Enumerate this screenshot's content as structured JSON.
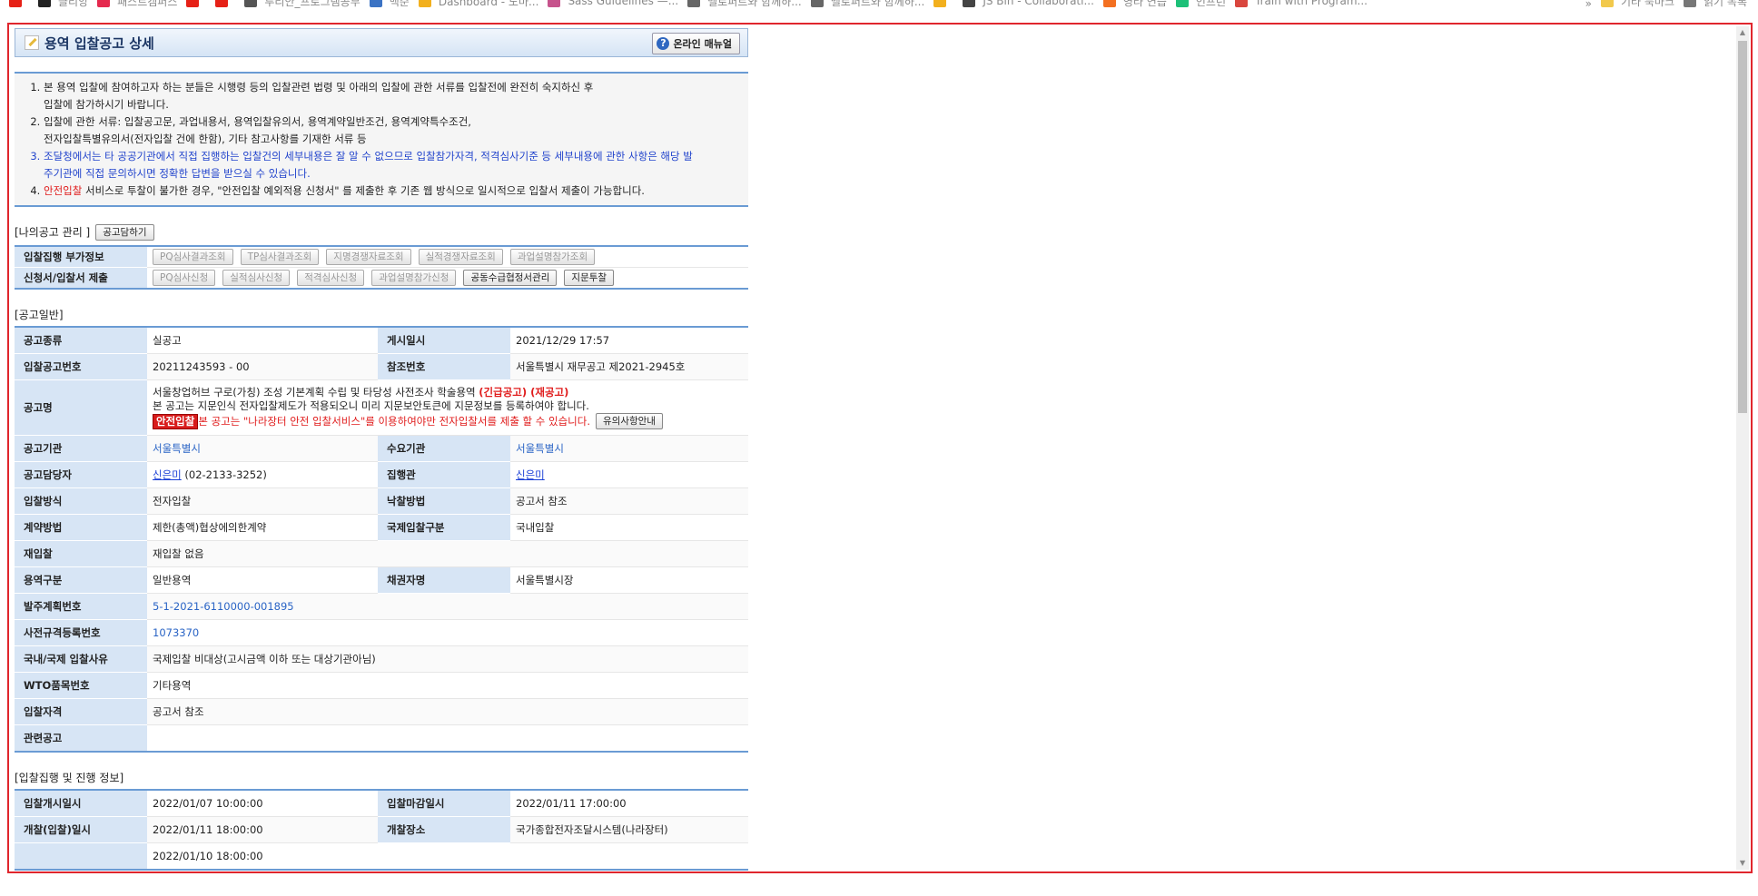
{
  "bookmarks": [
    {
      "icon": "youtube-icon",
      "label": ""
    },
    {
      "icon": "c-icon",
      "label": "클리앙"
    },
    {
      "icon": "fastcampus-icon",
      "label": "패스트캠퍼스"
    },
    {
      "icon": "youtube-icon",
      "label": ""
    },
    {
      "icon": "youtube-icon",
      "label": ""
    },
    {
      "icon": "branch-icon",
      "label": "투리안_프로그램공부"
    },
    {
      "icon": "code-icon",
      "label": "백준"
    },
    {
      "icon": "triangle-icon",
      "label": "Dashboard - 노마..."
    },
    {
      "icon": "sass-icon",
      "label": "Sass Guidelines —..."
    },
    {
      "icon": "book-icon",
      "label": "벨로퍼트와 함께하..."
    },
    {
      "icon": "book-icon",
      "label": "벨로퍼트와 함께하..."
    },
    {
      "icon": "triangle-icon",
      "label": ""
    },
    {
      "icon": "jsbin-icon",
      "label": "JS Bin - Collaborati..."
    },
    {
      "icon": "fire-icon",
      "label": "영타 연습"
    },
    {
      "icon": "inflearn-icon",
      "label": "인프런"
    },
    {
      "icon": "train-icon",
      "label": "Train with Program..."
    }
  ],
  "bookmarks_right": {
    "more": "»",
    "folder": "기타 북마크",
    "reading": "읽기 목록"
  },
  "title": "용역 입찰공고 상세",
  "manual_button": "온라인 매뉴얼",
  "notice": {
    "item1": "본 용역 입찰에 참여하고자 하는 분들은 시행령 등의 입찰관련 법령 및 아래의 입찰에 관한 서류를 입찰전에 완전히 숙지하신 후",
    "item1b": "입찰에 참가하시기 바랍니다.",
    "item2": "입찰에 관한 서류: 입찰공고문, 과업내용서, 용역입찰유의서, 용역계약일반조건, 용역계약특수조건,",
    "item2b": "전자입찰특별유의서(전자입찰 건에 한함), 기타 참고사항를 기재한 서류 등",
    "item3": "조달청에서는 타 공공기관에서 직접 집행하는 입찰건의 세부내용은 잘 알 수 없으므로 입찰참가자격, 적격심사기준 등 세부내용에 관한 사항은 해당 발",
    "item3b": "주기관에 직접 문의하시면 정확한 답변을 받으실 수 있습니다.",
    "item4_red": "안전입찰",
    "item4": " 서비스로 투찰이 불가한 경우, \"안전입찰 예외적용 신청서\" 를 제출한 후 기존 웹 방식으로 일시적으로 입찰서 제출이 가능합니다."
  },
  "my_notice": {
    "label": "[나의공고 관리 ]",
    "button": "공고담하기"
  },
  "extra": {
    "row1_label": "입찰집행 부가정보",
    "row1_buttons": [
      "PQ심사결과조회",
      "TP심사결과조회",
      "지명경쟁자료조회",
      "실적경쟁자료조회",
      "과업설명참가조회"
    ],
    "row2_label": "신청서/입찰서 제출",
    "row2_buttons": [
      "PQ심사신청",
      "실적심사신청",
      "적격심사신청",
      "과업설명참가신청",
      "공동수급협정서관리",
      "지문투찰"
    ]
  },
  "general": {
    "section": "[공고일반]",
    "r1": {
      "k1": "공고종류",
      "v1": "실공고",
      "k2": "게시일시",
      "v2": "2021/12/29 17:57"
    },
    "r2": {
      "k1": "입찰공고번호",
      "v1": "20211243593 - 00",
      "k2": "참조번호",
      "v2": "서울특별시 재무공고 제2021-2945호"
    },
    "r3": {
      "k1": "공고명",
      "line1": "서울창업허브 구로(가칭) 조성 기본계획 수립 및 타당성 사전조사 학술용역 ",
      "line1_red": "(긴급공고) (재공고)",
      "line2": "본 공고는 지문인식 전자입찰제도가 적용되오니 미리 지문보안토큰에 지문정보를 등록하여야 합니다.",
      "badge": "안전입찰",
      "line3_red": " 본 공고는 \"나라장터 안전 입찰서비스\"를 이용하여야만 전자입찰서를 제출 할 수 있습니다.",
      "button": "유의사항안내"
    },
    "r4": {
      "k1": "공고기관",
      "v1": "서울특별시",
      "k2": "수요기관",
      "v2": "서울특별시"
    },
    "r5": {
      "k1": "공고담당자",
      "v1_link": "신은미",
      "v1": " (02-2133-3252)",
      "k2": "집행관",
      "v2_link": "신은미"
    },
    "r6": {
      "k1": "입찰방식",
      "v1": "전자입찰",
      "k2": "낙찰방법",
      "v2": "공고서 참조"
    },
    "r7": {
      "k1": "계약방법",
      "v1": "제한(총액)협상에의한계약",
      "k2": "국제입찰구분",
      "v2": "국내입찰"
    },
    "r8": {
      "k1": "재입찰",
      "v1": "재입찰 없음"
    },
    "r9": {
      "k1": "용역구분",
      "v1": "일반용역",
      "k2": "채권자명",
      "v2": "서울특별시장"
    },
    "r10": {
      "k1": "발주계획번호",
      "v1": "5-1-2021-6110000-001895"
    },
    "r11": {
      "k1": "사전규격등록번호",
      "v1": "1073370"
    },
    "r12": {
      "k1": "국내/국제 입찰사유",
      "v1": "국제입찰 비대상(고시금액 이하 또는 대상기관아님)"
    },
    "r13": {
      "k1": "WTO품목번호",
      "v1": "기타용역"
    },
    "r14": {
      "k1": "입찰자격",
      "v1": "공고서 참조"
    },
    "r15": {
      "k1": "관련공고",
      "v1": ""
    }
  },
  "progress": {
    "section": "[입찰집행 및 진행 정보]",
    "r1": {
      "k1": "입찰개시일시",
      "v1": "2022/01/07 10:00:00",
      "k2": "입찰마감일시",
      "v2": "2022/01/11 17:00:00"
    },
    "r2": {
      "k1": "개찰(입찰)일시",
      "v1": "2022/01/11 18:00:00",
      "k2": "개찰장소",
      "v2": "국가종합전자조달시스템(나라장터)"
    },
    "r3": {
      "k1": "",
      "v1": "2022/01/10 18:00:00"
    }
  }
}
